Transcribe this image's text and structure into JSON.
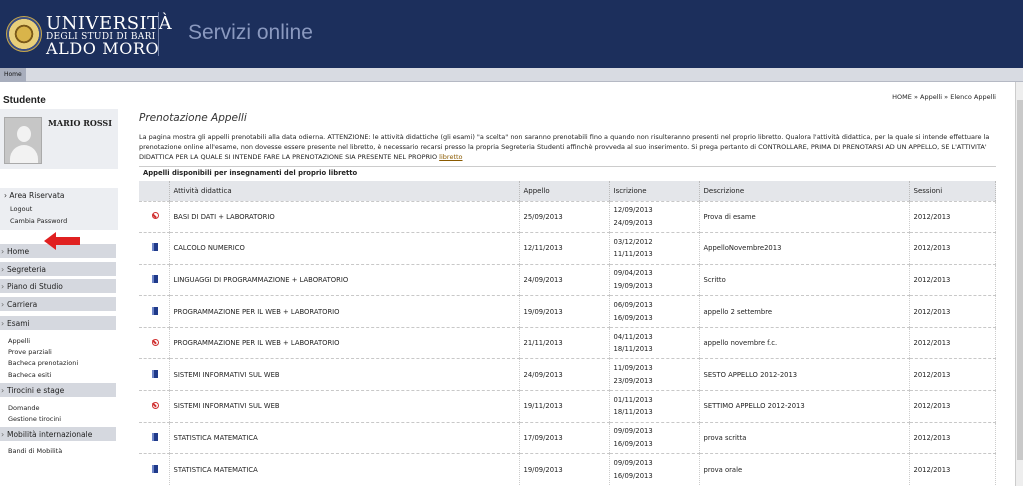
{
  "header": {
    "uni_line1": "UNIVERSITÀ",
    "uni_line2": "DEGLI STUDI DI BARI",
    "uni_line3": "ALDO MORO",
    "service_title": "Servizi online"
  },
  "topnav": {
    "home": "Home"
  },
  "sidebar": {
    "title": "Studente",
    "user_name": "MARIO ROSSI",
    "area_heading": "Area Riservata",
    "area_links": [
      "Logout",
      "Cambia Password"
    ],
    "menu": [
      "Home",
      "Segreteria",
      "Piano di Studio",
      "Carriera",
      "Esami"
    ],
    "esami_links": [
      "Appelli",
      "Prove parziali",
      "Bacheca prenotazioni",
      "Bacheca esiti"
    ],
    "tirocini": "Tirocini e stage",
    "tirocini_links": [
      "Domande",
      "Gestione tirocini"
    ],
    "mobilita": "Mobilità internazionale",
    "mobilita_links": [
      "Bandi di Mobilità"
    ]
  },
  "breadcrumb": "HOME » Appelli » Elenco Appelli",
  "page_title": "Prenotazione Appelli",
  "intro": {
    "text": "La pagina mostra gli appelli prenotabili alla data odierna. ATTENZIONE: le attività didattiche (gli esami) \"a scelta\" non saranno prenotabili fino a quando non risulteranno presenti nel proprio libretto. Qualora l'attività didattica, per la quale si intende effettuare la prenotazione online all'esame, non dovesse essere presente nel libretto, è necessario recarsi presso la propria Segreteria Studenti affinchè provveda al suo inserimento. Si prega pertanto di CONTROLLARE, PRIMA DI PRENOTARSI AD UN APPELLO, SE L'ATTIVITA' DIDATTICA PER LA QUALE SI INTENDE FARE LA PRENOTAZIONE SIA PRESENTE NEL PROPRIO ",
    "link": "libretto"
  },
  "table": {
    "caption": "Appelli disponibili per insegnamenti del proprio libretto",
    "headers": [
      "",
      "Attività didattica",
      "Appello",
      "Iscrizione",
      "Descrizione",
      "Sessioni"
    ],
    "rows": [
      {
        "icon": "no-entry-icon",
        "attivita": "BASI DI DATI + LABORATORIO",
        "appello": "25/09/2013",
        "iscr_from": "12/09/2013",
        "iscr_to": "24/09/2013",
        "descrizione": "Prova di esame",
        "sessioni": "2012/2013"
      },
      {
        "icon": "book-icon",
        "attivita": "CALCOLO NUMERICO",
        "appello": "12/11/2013",
        "iscr_from": "03/12/2012",
        "iscr_to": "11/11/2013",
        "descrizione": "AppelloNovembre2013",
        "sessioni": "2012/2013"
      },
      {
        "icon": "book-icon",
        "attivita": "LINGUAGGI DI PROGRAMMAZIONE + LABORATORIO",
        "appello": "24/09/2013",
        "iscr_from": "09/04/2013",
        "iscr_to": "19/09/2013",
        "descrizione": "Scritto",
        "sessioni": "2012/2013"
      },
      {
        "icon": "book-icon",
        "attivita": "PROGRAMMAZIONE PER IL WEB + LABORATORIO",
        "appello": "19/09/2013",
        "iscr_from": "06/09/2013",
        "iscr_to": "16/09/2013",
        "descrizione": "appello 2 settembre",
        "sessioni": "2012/2013"
      },
      {
        "icon": "no-entry-icon",
        "attivita": "PROGRAMMAZIONE PER IL WEB + LABORATORIO",
        "appello": "21/11/2013",
        "iscr_from": "04/11/2013",
        "iscr_to": "18/11/2013",
        "descrizione": "appello novembre f.c.",
        "sessioni": "2012/2013"
      },
      {
        "icon": "book-icon",
        "attivita": "SISTEMI INFORMATIVI SUL WEB",
        "appello": "24/09/2013",
        "iscr_from": "11/09/2013",
        "iscr_to": "23/09/2013",
        "descrizione": "SESTO APPELLO 2012-2013",
        "sessioni": "2012/2013"
      },
      {
        "icon": "no-entry-icon",
        "attivita": "SISTEMI INFORMATIVI SUL WEB",
        "appello": "19/11/2013",
        "iscr_from": "01/11/2013",
        "iscr_to": "18/11/2013",
        "descrizione": "SETTIMO APPELLO 2012-2013",
        "sessioni": "2012/2013"
      },
      {
        "icon": "book-icon",
        "attivita": "STATISTICA MATEMATICA",
        "appello": "17/09/2013",
        "iscr_from": "09/09/2013",
        "iscr_to": "16/09/2013",
        "descrizione": "prova scritta",
        "sessioni": "2012/2013"
      },
      {
        "icon": "book-icon",
        "attivita": "STATISTICA MATEMATICA",
        "appello": "19/09/2013",
        "iscr_from": "09/09/2013",
        "iscr_to": "16/09/2013",
        "descrizione": "prova orale",
        "sessioni": "2012/2013"
      }
    ]
  },
  "colors": {
    "header_bg": "#1c2f5c",
    "menu_bg": "#d5d8df",
    "arrow": "#e02020"
  }
}
